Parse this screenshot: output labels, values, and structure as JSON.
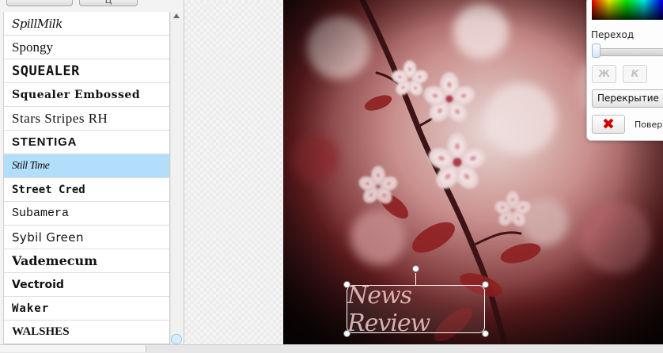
{
  "font_panel": {
    "top_tabs": [
      "",
      "Ц"
    ],
    "fonts": [
      {
        "label": "SpillMilk",
        "selected": false
      },
      {
        "label": "Spongy",
        "selected": false
      },
      {
        "label": "SQUEALER",
        "selected": false
      },
      {
        "label": "Squealer Embossed",
        "selected": false
      },
      {
        "label": "Stars Stripes RH",
        "selected": false
      },
      {
        "label": "STENTIGA",
        "selected": false
      },
      {
        "label": "Still Time",
        "selected": true
      },
      {
        "label": "Street Cred",
        "selected": false
      },
      {
        "label": "Subamera",
        "selected": false
      },
      {
        "label": "Sybil Green",
        "selected": false
      },
      {
        "label": "Vademecum",
        "selected": false
      },
      {
        "label": "Vectroid",
        "selected": false
      },
      {
        "label": "Waker",
        "selected": false
      },
      {
        "label": "WALSHES",
        "selected": false
      }
    ]
  },
  "canvas": {
    "text_object": {
      "text": "News Review"
    }
  },
  "properties": {
    "transition_label": "Переход",
    "transition_value": 0,
    "bold_label": "Ж",
    "italic_label": "К",
    "blend_mode": "Перекрытие",
    "layer_label": "Поверх"
  },
  "colors": {
    "selection": "#b3defb",
    "delete": "#d10000"
  }
}
